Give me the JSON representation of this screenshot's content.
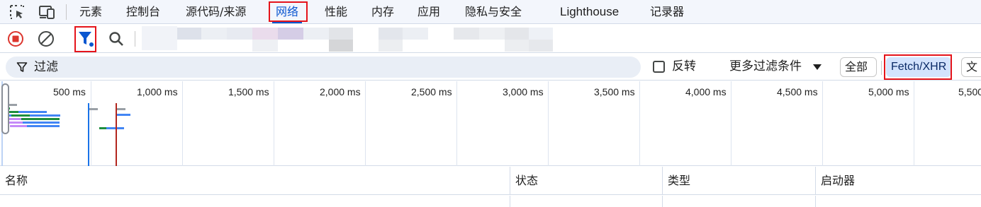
{
  "toolbar_top": {
    "icons": [
      "select-element-icon",
      "device-toolbar-icon"
    ],
    "tabs": [
      {
        "label": "元素"
      },
      {
        "label": "控制台"
      },
      {
        "label": "源代码/来源"
      },
      {
        "label": "网络"
      },
      {
        "label": "性能"
      },
      {
        "label": "内存"
      },
      {
        "label": "应用"
      },
      {
        "label": "隐私与安全"
      },
      {
        "label": "Lighthouse"
      },
      {
        "label": "记录器"
      }
    ],
    "active_tab": "网络"
  },
  "network_toolbar": {
    "icons": [
      "stop-recording-icon",
      "clear-icon",
      "filter-icon",
      "search-icon"
    ],
    "record_color": "#dc362e",
    "filter_active_color": "#0b57d0"
  },
  "filter_bar": {
    "placeholder": "过滤",
    "invert_label": "反转",
    "invert_checked": false,
    "more_filters_label": "更多过滤条件",
    "chips": [
      {
        "label": "全部",
        "selected": false
      },
      {
        "label": "Fetch/XHR",
        "selected": true
      },
      {
        "label": "文",
        "selected": false
      }
    ]
  },
  "timeline": {
    "ticks": [
      "500 ms",
      "1,000 ms",
      "1,500 ms",
      "2,000 ms",
      "2,500 ms",
      "3,000 ms",
      "3,500 ms",
      "4,000 ms",
      "4,500 ms",
      "5,000 ms",
      "5,500"
    ],
    "dom_content_loaded_color": "#1a73e8",
    "load_color": "#b3261e"
  },
  "table": {
    "columns": [
      "名称",
      "状态",
      "类型",
      "启动器"
    ]
  }
}
